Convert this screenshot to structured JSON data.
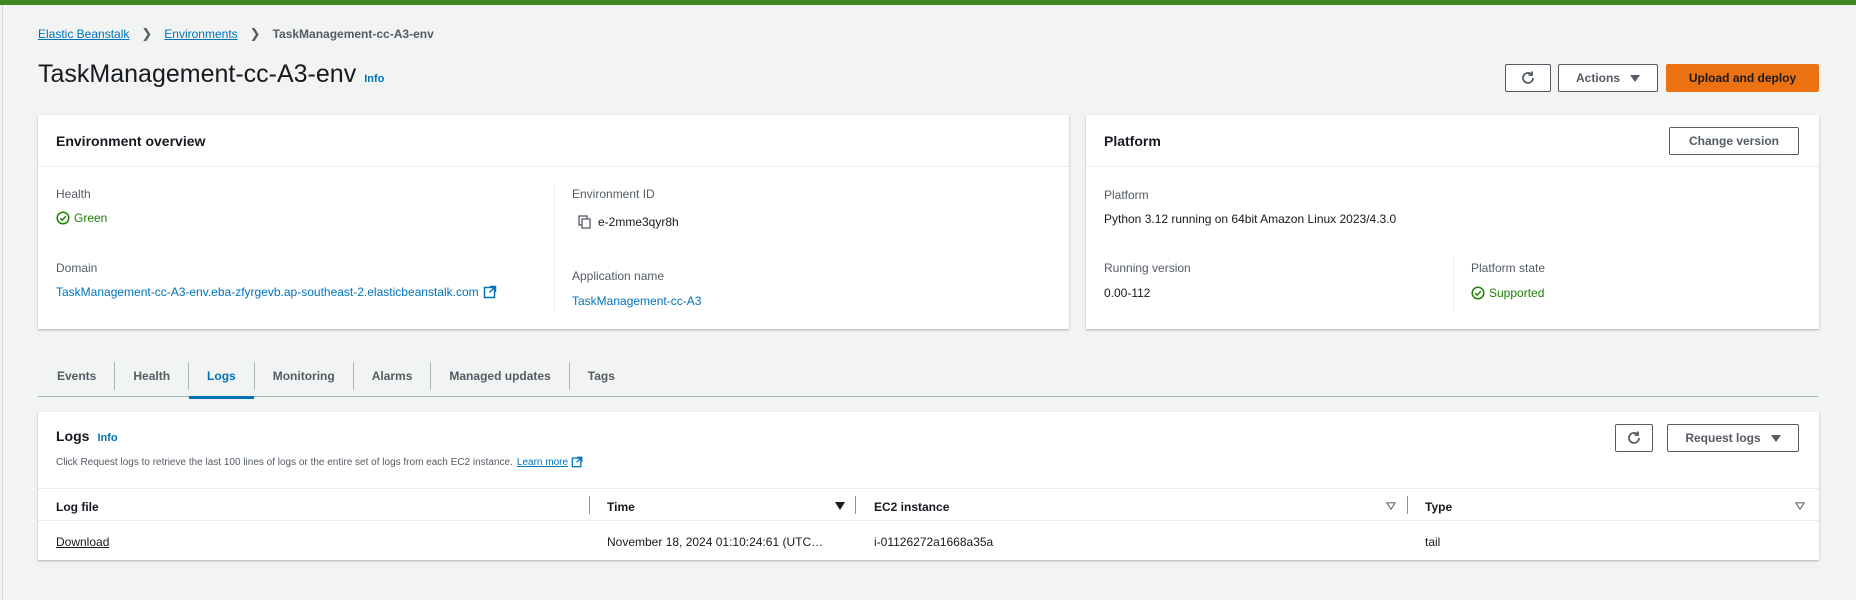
{
  "breadcrumb": {
    "items": [
      "Elastic Beanstalk",
      "Environments"
    ],
    "current": "TaskManagement-cc-A3-env"
  },
  "page": {
    "title": "TaskManagement-cc-A3-env",
    "info": "Info"
  },
  "header_actions": {
    "actions_label": "Actions",
    "upload_label": "Upload and deploy"
  },
  "overview": {
    "title": "Environment overview",
    "health_label": "Health",
    "health_value": "Green",
    "domain_label": "Domain",
    "domain_value": "TaskManagement-cc-A3-env.eba-zfyrgevb.ap-southeast-2.elasticbeanstalk.com",
    "env_id_label": "Environment ID",
    "env_id_value": "e-2mme3qyr8h",
    "app_name_label": "Application name",
    "app_name_value": "TaskManagement-cc-A3"
  },
  "platform": {
    "title": "Platform",
    "change_version_label": "Change version",
    "platform_label": "Platform",
    "platform_value": "Python 3.12 running on 64bit Amazon Linux 2023/4.3.0",
    "running_version_label": "Running version",
    "running_version_value": "0.00-112",
    "state_label": "Platform state",
    "state_value": "Supported"
  },
  "tabs": [
    "Events",
    "Health",
    "Logs",
    "Monitoring",
    "Alarms",
    "Managed updates",
    "Tags"
  ],
  "active_tab": "Logs",
  "logs": {
    "title": "Logs",
    "info": "Info",
    "description": "Click Request logs to retrieve the last 100 lines of logs or the entire set of logs from each EC2 instance.",
    "learn_more": "Learn more",
    "request_logs_label": "Request logs",
    "columns": [
      "Log file",
      "Time",
      "EC2 instance",
      "Type"
    ],
    "rows": [
      {
        "log_file": "Download",
        "time": "November 18, 2024 01:10:24:61 (UTC…",
        "ec2_instance": "i-01126272a1668a35a",
        "type": "tail"
      }
    ]
  },
  "colors": {
    "accent": "#0073bb",
    "success": "#1d8102",
    "primary_button": "#ec7211",
    "top_bar": "#3f8624"
  }
}
